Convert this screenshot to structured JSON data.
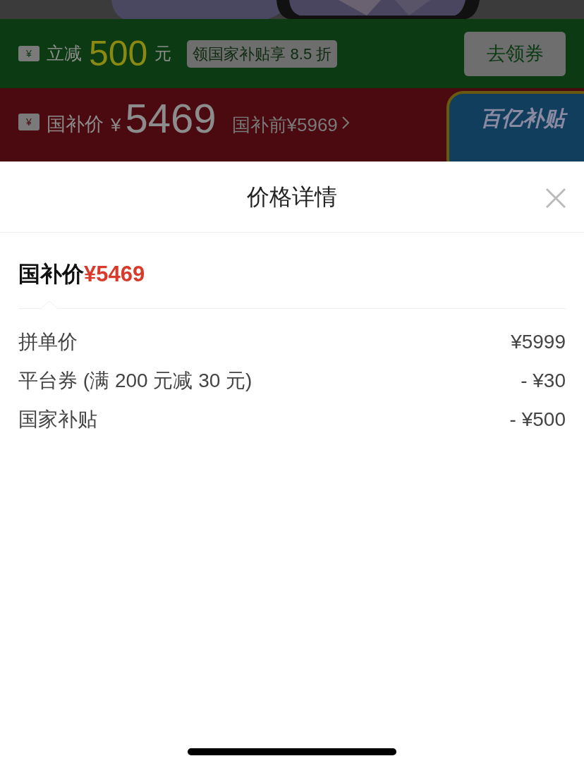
{
  "background": {
    "coupon_bar": {
      "icon_text": "¥",
      "label": "立减",
      "amount": "500",
      "unit": "元",
      "tag": "领国家补贴享 8.5 折",
      "button": "去领券"
    },
    "price_bar": {
      "icon_text": "¥",
      "label": "国补价",
      "currency": "¥",
      "price": "5469",
      "before_price": "国补前¥5969",
      "badge": "百亿补贴"
    }
  },
  "sheet": {
    "title": "价格详情",
    "summary": {
      "label": "国补价",
      "price": "¥5469"
    },
    "rows": [
      {
        "label": "拼单价",
        "value": "¥5999"
      },
      {
        "label": "平台券 (满 200 元减 30 元)",
        "value": "- ¥30"
      },
      {
        "label": "国家补贴",
        "value": "- ¥500"
      }
    ]
  }
}
